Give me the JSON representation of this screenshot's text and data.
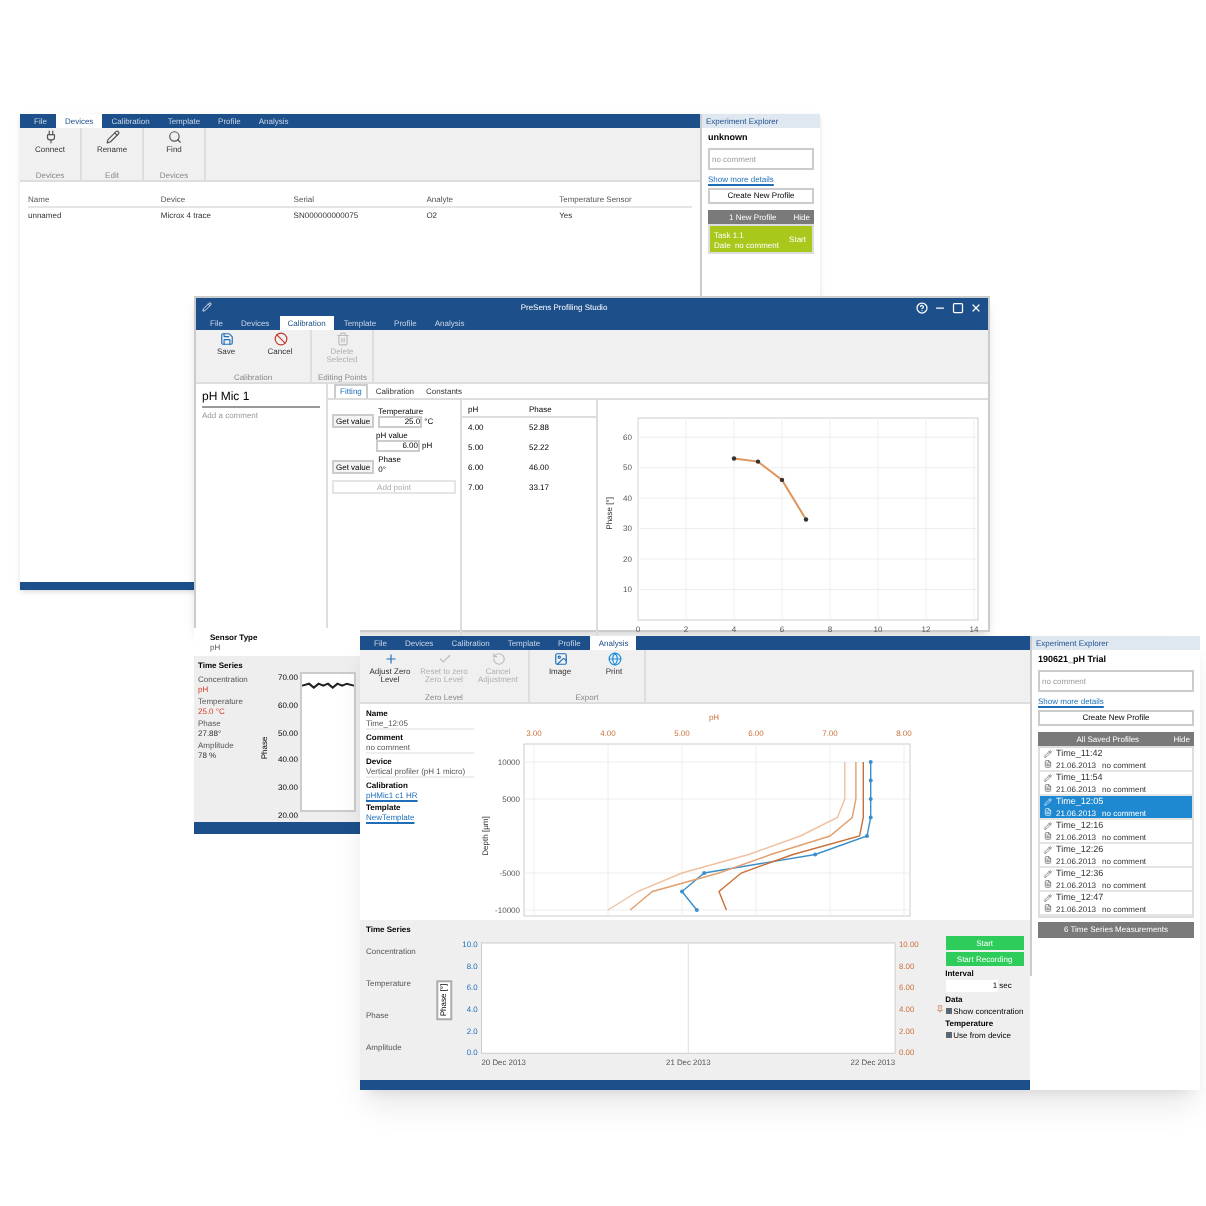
{
  "device_window": {
    "tabs": [
      {
        "label": "File",
        "selected": false
      },
      {
        "label": "Devices",
        "selected": true
      },
      {
        "label": "Calibration",
        "selected": false
      },
      {
        "label": "Template",
        "selected": false
      },
      {
        "label": "Profile",
        "selected": false
      },
      {
        "label": "Analysis",
        "selected": false
      }
    ],
    "toolbar_groups": [
      {
        "label": "Devices",
        "items": [
          {
            "label": "Connect",
            "kind": "plug",
            "disabled": false
          }
        ]
      },
      {
        "label": "Edit",
        "items": [
          {
            "label": "Rename",
            "kind": "pencil",
            "disabled": false
          }
        ]
      },
      {
        "label": "Devices",
        "items": [
          {
            "label": "Find",
            "kind": "search",
            "disabled": false
          }
        ]
      }
    ],
    "table": {
      "columns": [
        "Name",
        "Device",
        "Serial",
        "Analyte",
        "Temperature Sensor"
      ],
      "rows": [
        [
          "unnamed",
          "Microx 4 trace",
          "SN000000000075",
          "O2",
          "Yes"
        ]
      ]
    },
    "explorer": {
      "title": "Experiment Explorer",
      "name": "unknown",
      "comment_placeholder": "no comment",
      "details_link": "Show more details",
      "create_button": "Create New Profile",
      "list_header": "1 New Profile",
      "hide": "Hide",
      "items": [
        {
          "kind": "active",
          "name": "Task 1.1",
          "date": "Date",
          "comment": "no comment",
          "action": "Start",
          "selected": true
        }
      ]
    }
  },
  "sensor_window": {
    "sensor_type_label": "Sensor Type",
    "sensor_type": "pH",
    "time_series_title": "Time Series",
    "readings": [
      {
        "label": "Concentration",
        "value": "pH",
        "alert": true
      },
      {
        "label": "Temperature",
        "value": "25.0 °C",
        "alert": true
      },
      {
        "label": "Phase",
        "value": "27.88°",
        "alert": false
      },
      {
        "label": "Amplitude",
        "value": "78 %",
        "alert": false
      }
    ],
    "ylabel": "Phase",
    "yticks": [
      "70.00",
      "60.00",
      "50.00",
      "40.00",
      "30.00",
      "20.00"
    ]
  },
  "calibration_window": {
    "title": "PreSens Profiling Studio",
    "tabs": [
      {
        "label": "File",
        "selected": false
      },
      {
        "label": "Devices",
        "selected": false
      },
      {
        "label": "Calibration",
        "selected": true
      },
      {
        "label": "Template",
        "selected": false
      },
      {
        "label": "Profile",
        "selected": false
      },
      {
        "label": "Analysis",
        "selected": false
      }
    ],
    "toolbar_groups": [
      {
        "label": "Calibration",
        "items": [
          {
            "label": "Save",
            "kind": "save",
            "disabled": false
          },
          {
            "label": "Cancel",
            "kind": "cancel",
            "disabled": false
          }
        ]
      },
      {
        "label": "Editing Points",
        "items": [
          {
            "label": "Delete Selected",
            "kind": "trash",
            "disabled": true
          }
        ]
      }
    ],
    "sensor_name": "pH Mic 1",
    "comment_placeholder": "Add a comment",
    "subtabs": [
      {
        "label": "Fitting",
        "selected": true
      },
      {
        "label": "Calibration",
        "selected": false
      },
      {
        "label": "Constants",
        "selected": false
      }
    ],
    "form": {
      "temperature_label": "Temperature",
      "temperature": "25.0",
      "temperature_unit": "°C",
      "ph_label": "pH value",
      "ph": "6.00",
      "ph_unit": "pH",
      "phase_label": "Phase",
      "phase": "0°",
      "get_value": "Get value",
      "get_value_2": "Get value",
      "add_point": "Add point"
    },
    "points": {
      "columns": [
        "pH",
        "Phase"
      ],
      "rows": [
        [
          "4.00",
          "52.88"
        ],
        [
          "5.00",
          "52.22"
        ],
        [
          "6.00",
          "46.00"
        ],
        [
          "7.00",
          "33.17"
        ]
      ]
    },
    "chart_data": {
      "type": "line",
      "ylabel": "Phase [°]",
      "x": [
        4,
        5,
        6,
        7
      ],
      "grid": true,
      "series": [
        {
          "color": "#e0955a",
          "values": [
            53,
            52,
            46,
            33
          ]
        }
      ],
      "xlim": [
        0,
        14
      ],
      "ylim": [
        0,
        65
      ],
      "xticks": [
        0,
        2,
        4,
        6,
        8,
        10,
        12,
        14
      ],
      "yticks": [
        10,
        20,
        30,
        40,
        50,
        60
      ]
    }
  },
  "analysis_window": {
    "tabs": [
      {
        "label": "File",
        "selected": false
      },
      {
        "label": "Devices",
        "selected": false
      },
      {
        "label": "Calibration",
        "selected": false
      },
      {
        "label": "Template",
        "selected": false
      },
      {
        "label": "Profile",
        "selected": false
      },
      {
        "label": "Analysis",
        "selected": true
      }
    ],
    "toolbar_groups": [
      {
        "label": "Zero Level",
        "items": [
          {
            "label": "Adjust Zero Level",
            "kind": "plus",
            "disabled": false
          },
          {
            "label": "Reset to zero Zero Level",
            "kind": "check",
            "disabled": true
          },
          {
            "label": "Cancel Adjustment",
            "kind": "reset",
            "disabled": true
          }
        ]
      },
      {
        "label": "Export",
        "items": [
          {
            "label": "Image",
            "kind": "image",
            "disabled": false
          },
          {
            "label": "Print",
            "kind": "globe",
            "disabled": false
          }
        ]
      }
    ],
    "details": [
      {
        "kind": "text",
        "label": "Name",
        "value": "Time_12:05"
      },
      {
        "kind": "text",
        "label": "Comment",
        "value": "no comment"
      },
      {
        "kind": "text",
        "label": "Device",
        "value": "Vertical profiler (pH 1 micro)"
      },
      {
        "kind": "link",
        "label": "Calibration",
        "value": "pHMic1 c1 HR"
      },
      {
        "kind": "link",
        "label": "Template",
        "value": "NewTemplate"
      }
    ],
    "chart_data": {
      "type": "line",
      "orientation": "horizontal",
      "grid": true,
      "xlabel": "pH",
      "ylabel": "Depth [µm]",
      "x": [
        -10000,
        -7500,
        -5000,
        -2500,
        0,
        2500,
        5000,
        7500,
        10000
      ],
      "series": [
        {
          "color": "#3a8fc8",
          "values": [
            5.2,
            5.0,
            5.3,
            6.8,
            7.5,
            7.55,
            7.55,
            7.55,
            7.55
          ]
        },
        {
          "color": "#e0a070",
          "values": [
            4.3,
            4.6,
            5.5,
            6.2,
            7.0,
            7.3,
            7.35,
            7.35,
            7.35
          ]
        },
        {
          "color": "#c8703a",
          "values": [
            5.6,
            5.5,
            5.8,
            6.5,
            7.4,
            7.45,
            7.45,
            7.45,
            7.45
          ]
        },
        {
          "color": "#f0c0a0",
          "values": [
            4.0,
            4.4,
            5.0,
            5.9,
            6.6,
            7.1,
            7.2,
            7.2,
            7.2
          ]
        }
      ],
      "xlim": [
        3,
        8
      ],
      "ylim": [
        -10000,
        10000
      ],
      "xticks": [
        {
          "value": 3,
          "label": "3.00"
        },
        {
          "value": 4,
          "label": "4.00"
        },
        {
          "value": 5,
          "label": "5.00"
        },
        {
          "value": 6,
          "label": "6.00"
        },
        {
          "value": 7,
          "label": "7.00"
        },
        {
          "value": 8,
          "label": "8.00"
        }
      ],
      "yticks": [
        {
          "value": 10000,
          "label": "10000"
        },
        {
          "value": 5000,
          "label": "5000"
        },
        {
          "value": -5000,
          "label": "-5000"
        },
        {
          "value": -10000,
          "label": "-10000"
        }
      ]
    },
    "time_series": {
      "title": "Time Series",
      "channels": [
        "Concentration",
        "Temperature",
        "Phase",
        "Amplitude"
      ],
      "axis_selector": "Phase [°]",
      "left_ticks": [
        "10.0",
        "8.0",
        "6.0",
        "4.0",
        "2.0",
        "0.0"
      ],
      "right_ticks": [
        "10.00",
        "8.00",
        "6.00",
        "4.00",
        "2.00",
        "0.00"
      ],
      "x_labels": [
        "20 Dec 2013",
        "21 Dec 2013",
        "22 Dec 2013"
      ],
      "start": "Start",
      "record": "Start Recording",
      "interval_label": "Interval",
      "interval": "1",
      "interval_unit": "sec",
      "data_label": "Data",
      "show_concentration": {
        "label": "Show concentration",
        "checked": true
      },
      "temperature_label": "Temperature",
      "use_device": {
        "label": "Use from device",
        "checked": true
      }
    },
    "explorer": {
      "title": "Experiment Explorer",
      "name": "190621_pH Trial",
      "comment_placeholder": "no comment",
      "details_link": "Show more details",
      "create_button": "Create New Profile",
      "list_header": "All Saved Profiles",
      "hide": "Hide",
      "items": [
        {
          "kind": "saved",
          "name": "Time_11:42",
          "date": "21.06.2013",
          "comment": "no comment",
          "selected": false
        },
        {
          "kind": "saved",
          "name": "Time_11:54",
          "date": "21.06.2013",
          "comment": "no comment",
          "selected": false
        },
        {
          "kind": "saved",
          "name": "Time_12:05",
          "date": "21.06.2013",
          "comment": "no comment",
          "selected": true
        },
        {
          "kind": "saved",
          "name": "Time_12:16",
          "date": "21.06.2013",
          "comment": "no comment",
          "selected": false
        },
        {
          "kind": "saved",
          "name": "Time_12:26",
          "date": "21.06.2013",
          "comment": "no comment",
          "selected": false
        },
        {
          "kind": "saved",
          "name": "Time_12:36",
          "date": "21.06.2013",
          "comment": "no comment",
          "selected": false
        },
        {
          "kind": "saved",
          "name": "Time_12:47",
          "date": "21.06.2013",
          "comment": "no comment",
          "selected": false
        }
      ],
      "footer_button": "6 Time Series Measurements"
    }
  }
}
